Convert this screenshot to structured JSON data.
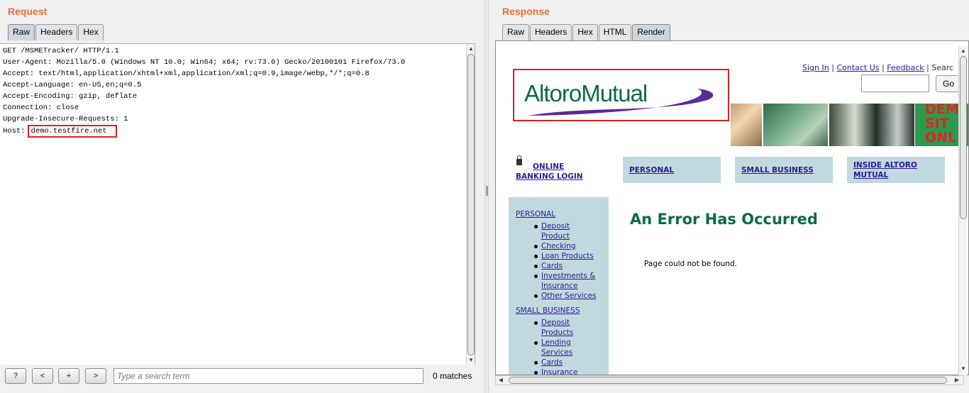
{
  "request": {
    "title": "Request",
    "tabs": [
      "Raw",
      "Headers",
      "Hex"
    ],
    "active_tab": "Raw",
    "lines": [
      "GET /MSMETracker/ HTTP/1.1",
      "User-Agent: Mozilla/5.0 (Windows NT 10.0; Win64; x64; rv:73.0) Gecko/20100101 Firefox/73.0",
      "Accept: text/html,application/xhtml+xml,application/xml;q=0.9,image/webp,*/*;q=0.8",
      "Accept-Language: en-US,en;q=0.5",
      "Accept-Encoding: gzip, deflate",
      "Connection: close",
      "Upgrade-Insecure-Requests: 1"
    ],
    "host_label": "Host:",
    "host_value": "demo.testfire.net"
  },
  "search": {
    "help_label": "?",
    "prev_label": "<",
    "add_label": "+",
    "next_label": ">",
    "placeholder": "Type a search term",
    "matches": "0 matches"
  },
  "response": {
    "title": "Response",
    "tabs": [
      "Raw",
      "Headers",
      "Hex",
      "HTML",
      "Render"
    ],
    "active_tab": "Render"
  },
  "site": {
    "logo": "AltoroMutual",
    "sign_in": "Sign In",
    "contact_us": "Contact Us",
    "feedback": "Feedback",
    "search_partial": "Searc",
    "sep": "|",
    "go": "Go",
    "demo_lines": [
      "DEM",
      "SIT",
      "ONL"
    ],
    "online_banking_line1": "ONLINE",
    "online_banking_line2": "BANKING LOGIN",
    "nav_personal": "PERSONAL",
    "nav_small_business": "SMALL BUSINESS",
    "nav_inside_line1": "INSIDE ALTORO",
    "nav_inside_line2": "MUTUAL",
    "sidebar_personal": "PERSONAL",
    "sidebar_personal_items": [
      [
        "Deposit",
        "Product"
      ],
      [
        "Checking"
      ],
      [
        "Loan Products"
      ],
      [
        "Cards"
      ],
      [
        "Investments &",
        "Insurance"
      ],
      [
        "Other Services"
      ]
    ],
    "sidebar_small_business": "SMALL BUSINESS",
    "sidebar_sb_items": [
      [
        "Deposit",
        "Products"
      ],
      [
        "Lending",
        "Services"
      ],
      [
        "Cards"
      ],
      [
        "Insurance"
      ]
    ],
    "error_title": "An Error Has Occurred",
    "error_message": "Page could not be found.",
    "colors": {
      "brand_green": "#0b6a4c",
      "link": "#2a1b96",
      "nav_bg": "#c0d9de",
      "highlight": "#e01e1e"
    }
  }
}
